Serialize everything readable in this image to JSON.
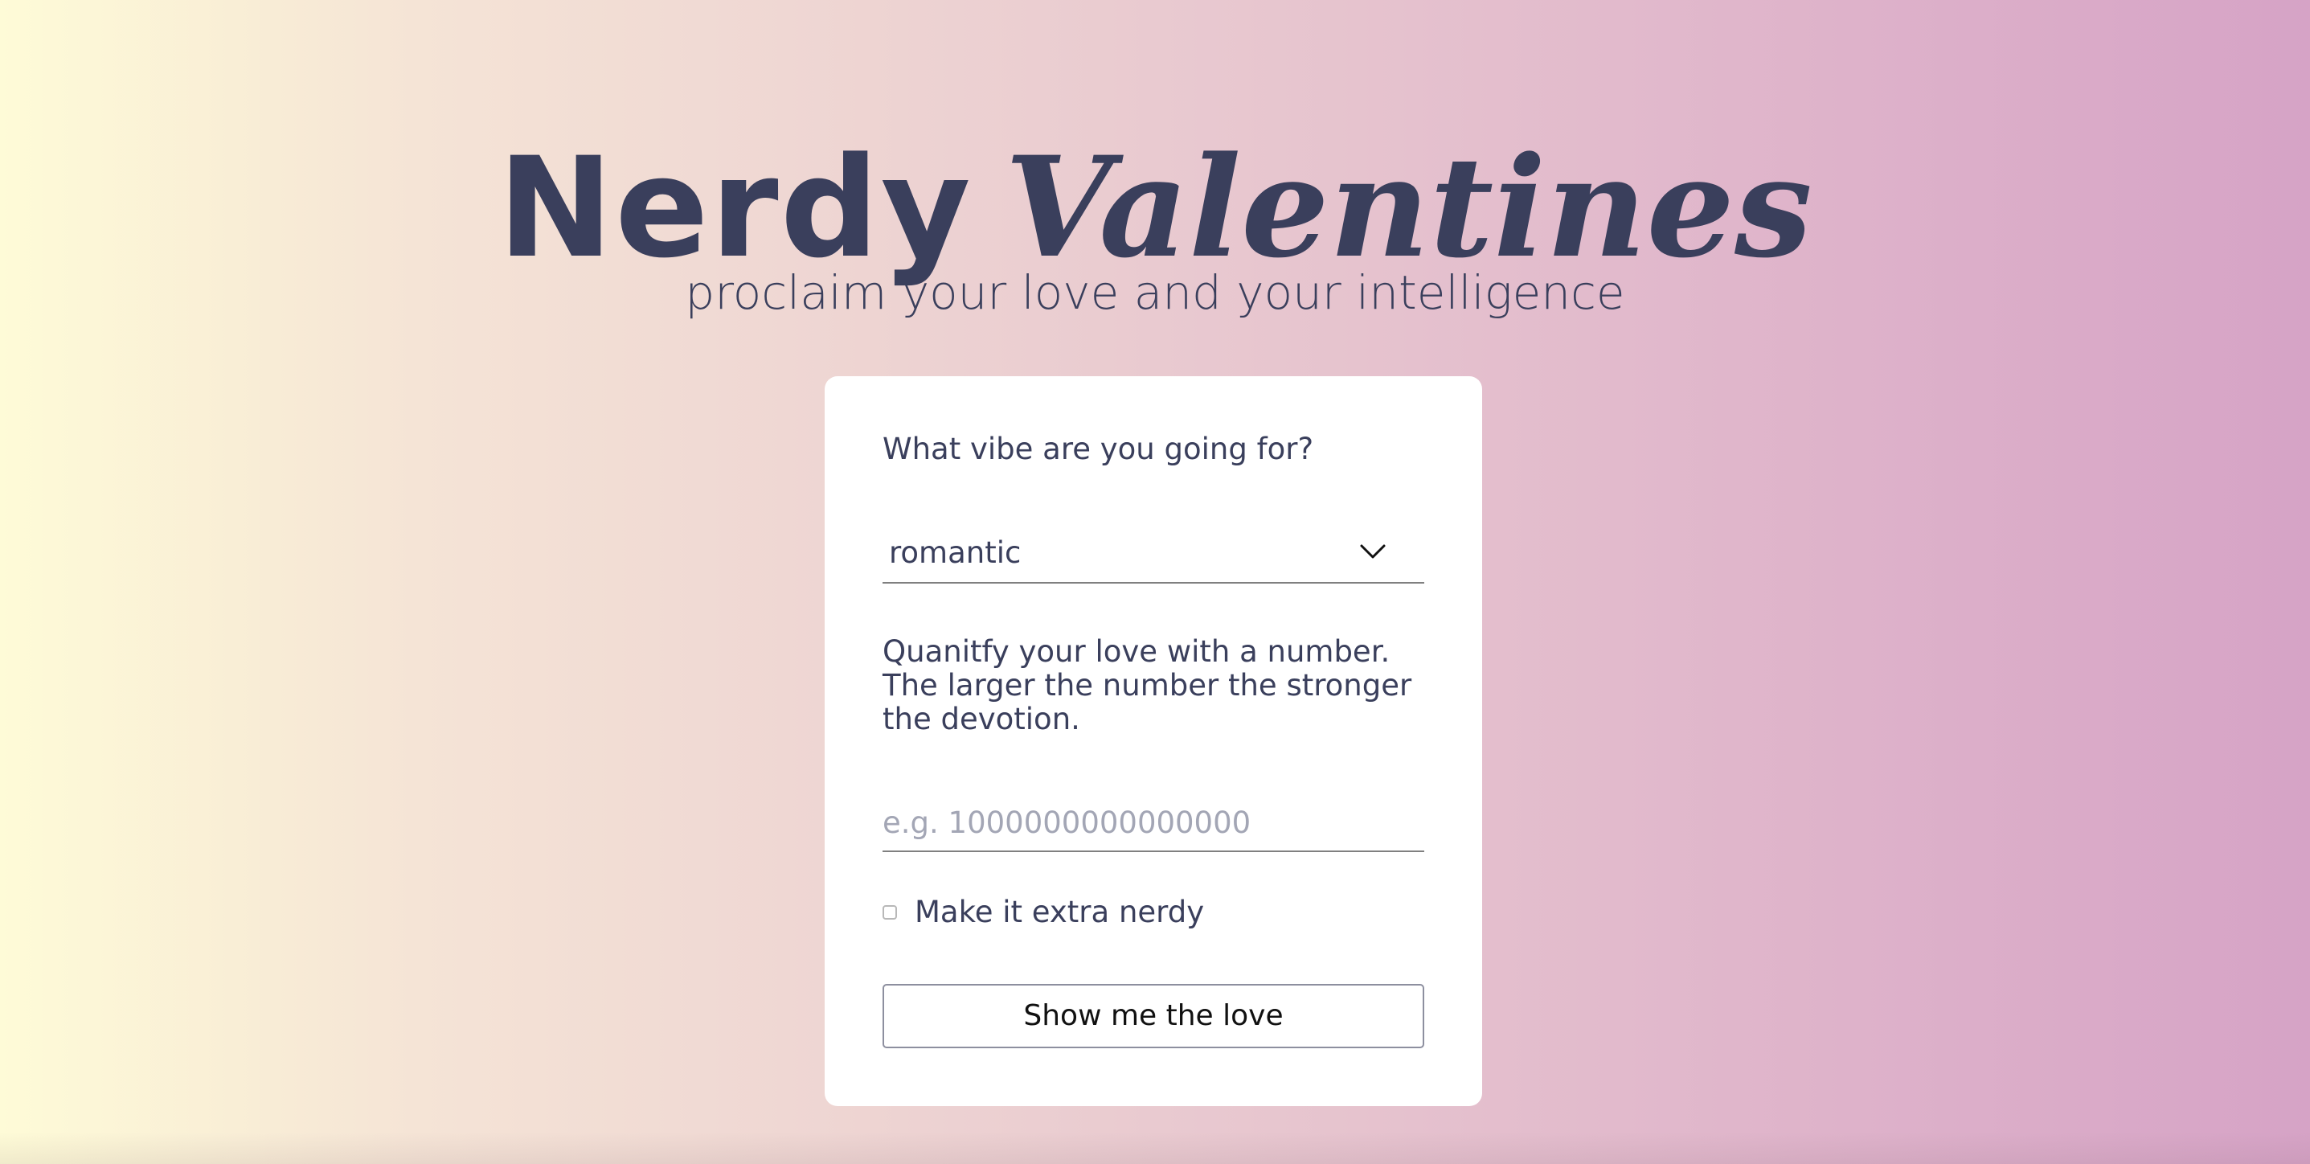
{
  "header": {
    "title_part1": "Nerdy",
    "title_part2": "Valentines",
    "subtitle": "proclaim your love and your intelligence"
  },
  "form": {
    "vibe_label": "What vibe are you going for?",
    "vibe_selected": "romantic",
    "number_label": "Quanitfy your love with a number. The larger the number the stronger the devotion.",
    "number_value": "",
    "number_placeholder": "e.g. 1000000000000000",
    "extra_nerdy_label": "Make it extra nerdy",
    "extra_nerdy_checked": false,
    "submit_label": "Show me the love"
  },
  "icons": {
    "select_arrow": "chevron-down-icon"
  },
  "colors": {
    "text": "#3a3f5c",
    "card_background": "#ffffff",
    "gradient_left": "#fefbd7",
    "gradient_right": "#d6a3c6"
  }
}
